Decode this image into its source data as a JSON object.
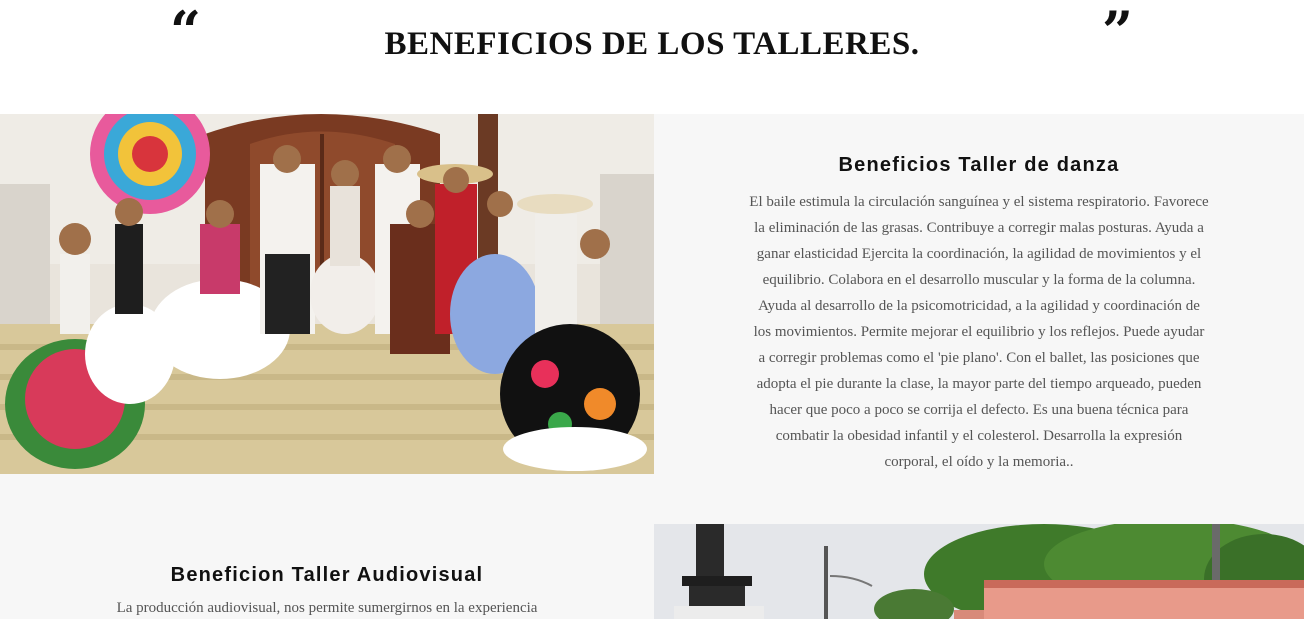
{
  "header": {
    "open_quote": "“",
    "close_quote": "”",
    "title": "BENEFICIOS DE LOS TALLERES."
  },
  "sections": [
    {
      "title": "Beneficios Taller de danza",
      "body": "El baile estimula la circulación sanguínea y el sistema respiratorio. Favorece la eliminación de las grasas. Contribuye a corregir malas posturas. Ayuda a ganar elasticidad Ejercita la coordinación, la agilidad de movimientos y el equilibrio. Colabora en el desarrollo muscular y la forma de la columna. Ayuda al desarrollo de la psicomotricidad, a la agilidad y coordinación de los movimientos. Permite mejorar el equilibrio y los reflejos. Puede ayudar a corregir problemas como el 'pie plano'. Con el ballet, las posiciones que adopta el pie durante la clase, la mayor parte del tiempo arqueado, pueden hacer que poco a poco se corrija el defecto. Es una buena técnica para combatir la obesidad infantil y el colesterol. Desarrolla la expresión corporal, el oído y la memoria..",
      "image_icon": "folk-dancers-photo"
    },
    {
      "title": "Beneficion Taller Audiovisual",
      "body": "La producción audiovisual, nos permite sumergirnos en la experiencia",
      "image_icon": "town-statue-photo"
    }
  ],
  "colors": {
    "page_bg": "#f7f7f7",
    "header_bg": "#ffffff",
    "heading": "#111111",
    "body_text": "#555555"
  }
}
